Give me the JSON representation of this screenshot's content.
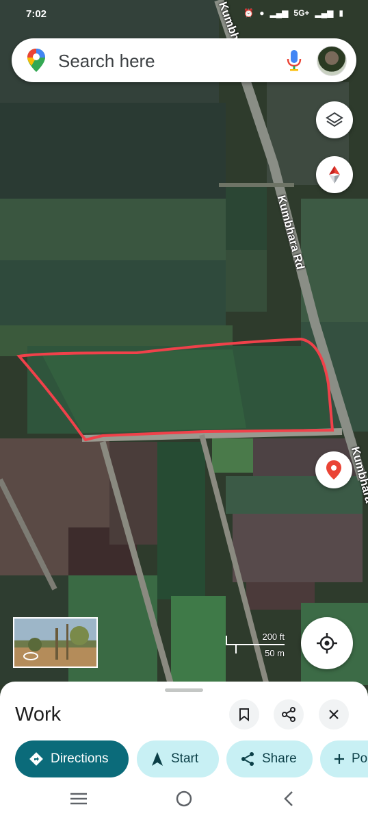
{
  "status_bar": {
    "time": "7:02",
    "network": "5G+"
  },
  "search": {
    "placeholder": "Search here"
  },
  "map": {
    "road_label_upper": "Kumbhara Rd",
    "road_label_top": "Kumbh",
    "road_label_right": "Kumbhara",
    "scale_feet": "200 ft",
    "scale_meters": "50 m",
    "field_outline_color": "#f0414a",
    "pin_color": "#ea4335"
  },
  "place_sheet": {
    "title": "Work",
    "actions": {
      "directions": "Directions",
      "start": "Start",
      "share": "Share",
      "more": "Po"
    }
  },
  "colors": {
    "primary_chip": "#0b6b7a",
    "secondary_chip": "#c8f0f4"
  }
}
